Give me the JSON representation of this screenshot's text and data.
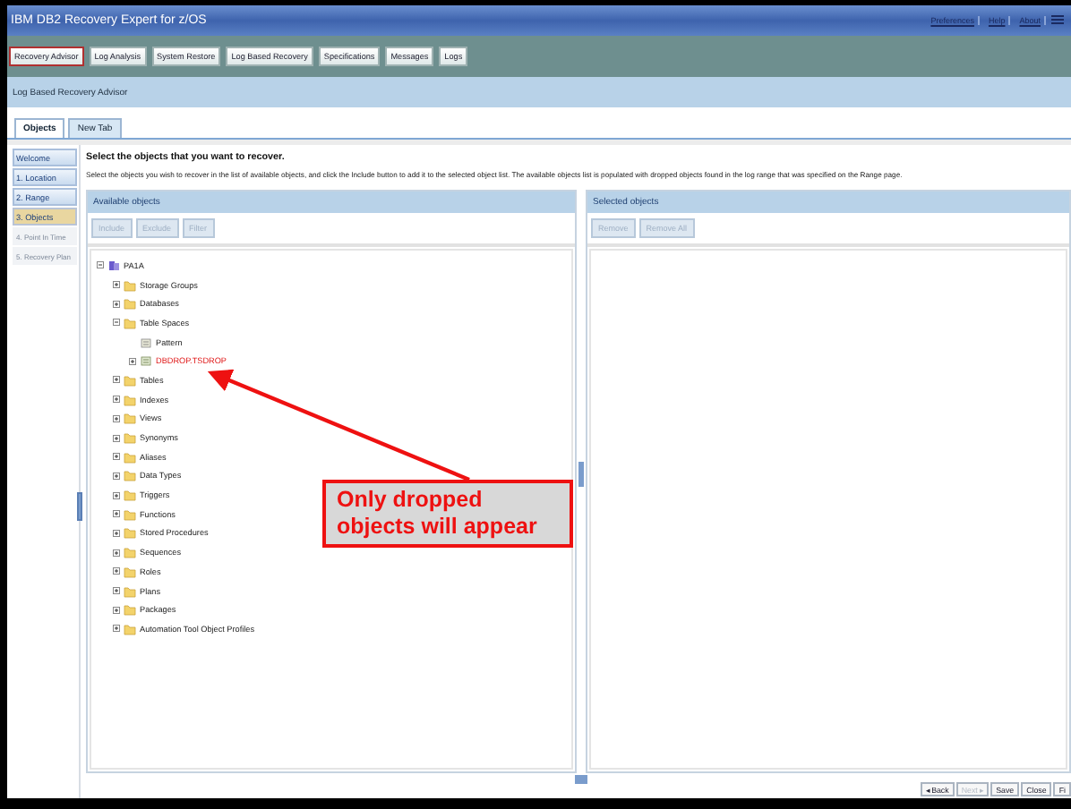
{
  "window": {
    "title": "IBM DB2 Recovery Expert for z/OS"
  },
  "header_links": [
    {
      "label": "Preferences"
    },
    {
      "label": "Help"
    },
    {
      "label": "About"
    }
  ],
  "nav_tabs": [
    {
      "label": "Recovery Advisor",
      "selected": true
    },
    {
      "label": "Log Analysis",
      "selected": false
    },
    {
      "label": "System Restore",
      "selected": false
    },
    {
      "label": "Log Based Recovery",
      "selected": false
    },
    {
      "label": "Specifications",
      "selected": false
    },
    {
      "label": "Messages",
      "selected": false
    },
    {
      "label": "Logs",
      "selected": false
    }
  ],
  "page_title": "Log Based Recovery Advisor",
  "tabs": [
    {
      "label": "Objects",
      "selected": true
    },
    {
      "label": "New Tab",
      "selected": false
    }
  ],
  "steps": [
    {
      "label": "Welcome",
      "selected": false,
      "disabled": false
    },
    {
      "label": "1. Location",
      "selected": false,
      "disabled": false
    },
    {
      "label": "2. Range",
      "selected": false,
      "disabled": false
    },
    {
      "label": "3. Objects",
      "selected": true,
      "disabled": false
    },
    {
      "label": "4. Point In Time",
      "selected": false,
      "disabled": true
    },
    {
      "label": "5. Recovery Plan",
      "selected": false,
      "disabled": true
    }
  ],
  "heading": "Select the objects that you want to recover.",
  "description": "Select the objects you wish to recover in the list of available objects, and click the Include button to add it to the selected object list.  The available objects list is populated with dropped objects found in the log range that was specified on the Range page.",
  "available": {
    "title": "Available objects",
    "buttons": [
      {
        "label": "Include",
        "disabled": true
      },
      {
        "label": "Exclude",
        "disabled": true
      },
      {
        "label": "Filter",
        "disabled": true
      }
    ],
    "tree": [
      {
        "label": "PA1A",
        "kind": "subsystem",
        "expanded": true,
        "children": [
          {
            "label": "Storage Groups",
            "kind": "folder",
            "expanded": false
          },
          {
            "label": "Databases",
            "kind": "folder",
            "expanded": false
          },
          {
            "label": "Table Spaces",
            "kind": "folder",
            "expanded": true,
            "children": [
              {
                "label": "Pattern",
                "kind": "pattern"
              },
              {
                "label": "DBDROP.TSDROP",
                "kind": "dropped_tablespace",
                "expanded": false
              }
            ]
          },
          {
            "label": "Tables",
            "kind": "folder",
            "expanded": false
          },
          {
            "label": "Indexes",
            "kind": "folder",
            "expanded": false
          },
          {
            "label": "Views",
            "kind": "folder",
            "expanded": false
          },
          {
            "label": "Synonyms",
            "kind": "folder",
            "expanded": false
          },
          {
            "label": "Aliases",
            "kind": "folder",
            "expanded": false
          },
          {
            "label": "Data Types",
            "kind": "folder",
            "expanded": false
          },
          {
            "label": "Triggers",
            "kind": "folder",
            "expanded": false
          },
          {
            "label": "Functions",
            "kind": "folder",
            "expanded": false
          },
          {
            "label": "Stored Procedures",
            "kind": "folder",
            "expanded": false
          },
          {
            "label": "Sequences",
            "kind": "folder",
            "expanded": false
          },
          {
            "label": "Roles",
            "kind": "folder",
            "expanded": false
          },
          {
            "label": "Plans",
            "kind": "folder",
            "expanded": false
          },
          {
            "label": "Packages",
            "kind": "folder",
            "expanded": false
          },
          {
            "label": "Automation Tool Object Profiles",
            "kind": "folder",
            "expanded": false
          }
        ]
      }
    ]
  },
  "selected_panel": {
    "title": "Selected objects",
    "buttons": [
      {
        "label": "Remove",
        "disabled": true
      },
      {
        "label": "Remove All",
        "disabled": true
      }
    ]
  },
  "footer_buttons": [
    {
      "label": "◂ Back",
      "disabled": false
    },
    {
      "label": "Next ▸",
      "disabled": true
    },
    {
      "label": "Save",
      "disabled": false
    },
    {
      "label": "Close",
      "disabled": false
    },
    {
      "label": "Fi",
      "disabled": false
    }
  ],
  "callout": {
    "text": "Only dropped objects will appear"
  }
}
